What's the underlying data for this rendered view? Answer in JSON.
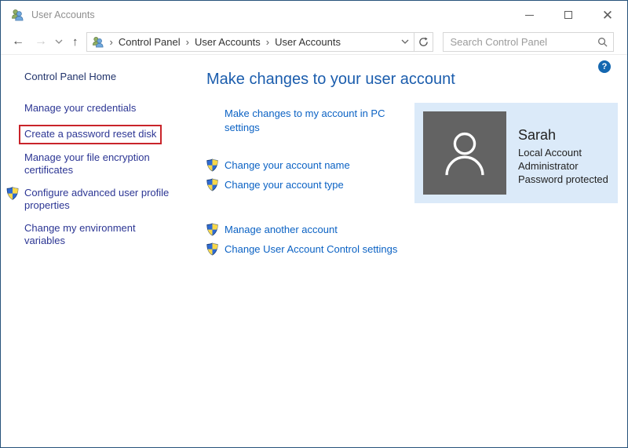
{
  "window": {
    "title": "User Accounts"
  },
  "navbar": {
    "breadcrumb": {
      "segments": [
        "Control Panel",
        "User Accounts",
        "User Accounts"
      ]
    },
    "search_placeholder": "Search Control Panel"
  },
  "sidebar": {
    "home_label": "Control Panel Home",
    "items": [
      {
        "label": "Manage your credentials",
        "shield": false,
        "highlighted": false
      },
      {
        "label": "Create a password reset disk",
        "shield": false,
        "highlighted": true
      },
      {
        "label": "Manage your file encryption certificates",
        "shield": false,
        "highlighted": false
      },
      {
        "label": "Configure advanced user profile properties",
        "shield": true,
        "highlighted": false
      },
      {
        "label": "Change my environment variables",
        "shield": false,
        "highlighted": false
      }
    ]
  },
  "main": {
    "heading": "Make changes to your user account",
    "links": [
      {
        "label": "Make changes to my account in PC settings",
        "shield": false
      },
      {
        "label": "Change your account name",
        "shield": true
      },
      {
        "label": "Change your account type",
        "shield": true
      },
      {
        "label": "Manage another account",
        "shield": true
      },
      {
        "label": "Change User Account Control settings",
        "shield": true
      }
    ]
  },
  "user_card": {
    "name": "Sarah",
    "details": [
      "Local Account",
      "Administrator",
      "Password protected"
    ]
  },
  "help": {
    "label": "?"
  },
  "colors": {
    "link_blue": "#0b62c4",
    "sidebar_link": "#2c3694",
    "heading_blue": "#1b5dad",
    "highlight_red": "#c9242a",
    "card_bg": "#dbeaf9",
    "avatar_gray": "#636363",
    "window_border": "#27537b"
  }
}
